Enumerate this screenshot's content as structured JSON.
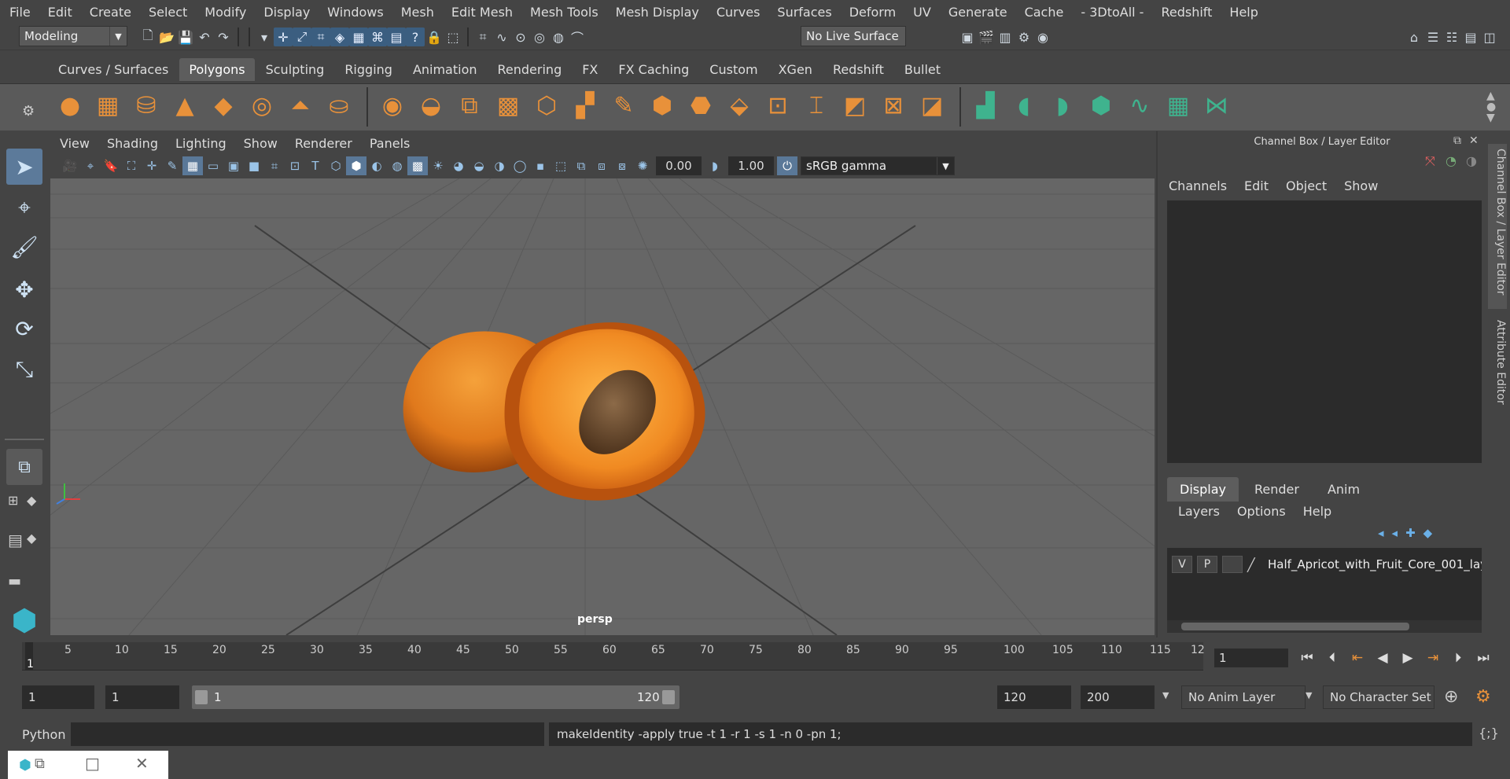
{
  "menubar": {
    "items": [
      "File",
      "Edit",
      "Create",
      "Select",
      "Modify",
      "Display",
      "Windows",
      "Mesh",
      "Edit Mesh",
      "Mesh Tools",
      "Mesh Display",
      "Curves",
      "Surfaces",
      "Deform",
      "UV",
      "Generate",
      "Cache",
      "- 3DtoAll -",
      "Redshift",
      "Help"
    ]
  },
  "toolbar": {
    "mode": "Modeling",
    "live_surface": "No Live Surface"
  },
  "shelf": {
    "tabs": [
      "Curves / Surfaces",
      "Polygons",
      "Sculpting",
      "Rigging",
      "Animation",
      "Rendering",
      "FX",
      "FX Caching",
      "Custom",
      "XGen",
      "Redshift",
      "Bullet"
    ],
    "active": "Polygons"
  },
  "viewport": {
    "menu": [
      "View",
      "Shading",
      "Lighting",
      "Show",
      "Renderer",
      "Panels"
    ],
    "exposure": "0.00",
    "gamma": "1.00",
    "colorspace": "sRGB gamma",
    "camera": "persp"
  },
  "channel_box": {
    "title": "Channel Box / Layer Editor",
    "menu": [
      "Channels",
      "Edit",
      "Object",
      "Show"
    ]
  },
  "layer_editor": {
    "tabs": [
      "Display",
      "Render",
      "Anim"
    ],
    "active": "Display",
    "menu": [
      "Layers",
      "Options",
      "Help"
    ],
    "layer": {
      "v": "V",
      "p": "P",
      "name": "Half_Apricot_with_Fruit_Core_001_lay"
    }
  },
  "side_tabs": [
    "Channel Box / Layer Editor",
    "Attribute Editor"
  ],
  "timeline": {
    "start_marker": "1",
    "ticks": [
      "5",
      "10",
      "15",
      "20",
      "25",
      "30",
      "35",
      "40",
      "45",
      "50",
      "55",
      "60",
      "65",
      "70",
      "75",
      "80",
      "85",
      "90",
      "95",
      "100",
      "105",
      "110",
      "115",
      "12"
    ],
    "current_frame": "1"
  },
  "range": {
    "start": "1",
    "playback_start": "1",
    "slider_start": "1",
    "slider_end": "120",
    "playback_end": "120",
    "end": "200",
    "anim_layer": "No Anim Layer",
    "char_set": "No Character Set"
  },
  "command": {
    "lang": "Python",
    "text": "makeIdentity -apply true -t 1 -r 1 -s 1 -n 0 -pn 1;"
  }
}
